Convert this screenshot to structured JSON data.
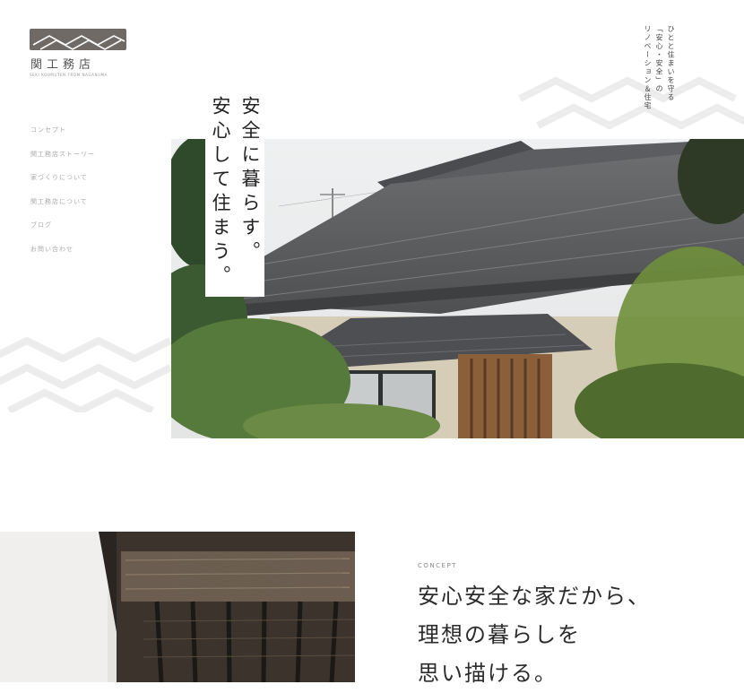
{
  "logo": {
    "name": "関工務店",
    "subtitle": "SEKI KOUMUTEN FROM NAGANUMA"
  },
  "nav": {
    "items": [
      {
        "label": "コンセプト"
      },
      {
        "label": "関工務店ストーリー"
      },
      {
        "label": "家づくりについて"
      },
      {
        "label": "関工務店について"
      },
      {
        "label": "ブログ"
      },
      {
        "label": "お問い合わせ"
      }
    ]
  },
  "tagline": {
    "lines": [
      "ひとと住まいを守る",
      "「安心・安全」の",
      "リノベーション＆住宅"
    ]
  },
  "hero": {
    "headline_lines": [
      "安全に暮らす。",
      "安心して住まう。"
    ]
  },
  "concept": {
    "label": "CONCEPT",
    "heading_lines": [
      "安心安全な家だから、",
      "理想の暮らしを",
      "思い描ける。"
    ]
  },
  "colors": {
    "logo_gray": "#6f6a66",
    "pattern": "#e9e9e9",
    "text_dark": "#222222"
  }
}
